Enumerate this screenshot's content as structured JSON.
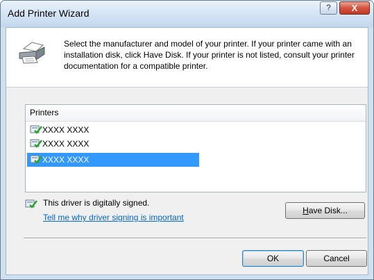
{
  "window": {
    "title": "Add Printer Wizard",
    "help_label": "?",
    "close_label": "X"
  },
  "header": {
    "icon": "printer-icon",
    "description": "Select the manufacturer and model of your printer. If your printer came with an installation disk, click Have Disk. If your printer is not listed, consult your printer documentation for a compatible printer."
  },
  "printers_list": {
    "column_header": "Printers",
    "items": [
      {
        "label": "XXXX XXXX",
        "icon": "signed-driver-icon",
        "selected": false
      },
      {
        "label": "XXXX XXXX",
        "icon": "signed-driver-icon",
        "selected": false
      },
      {
        "label": "XXXX XXXX",
        "icon": "signed-driver-icon",
        "selected": true
      }
    ]
  },
  "signature": {
    "icon": "signed-driver-icon",
    "status_text": "This driver is digitally signed.",
    "link_text": "Tell me why driver signing is important"
  },
  "buttons": {
    "have_disk_mnemonic": "H",
    "have_disk_rest": "ave Disk...",
    "ok": "OK",
    "cancel": "Cancel"
  },
  "colors": {
    "selection": "#3399ff",
    "link": "#0066cc",
    "close_button": "#c23a26"
  }
}
